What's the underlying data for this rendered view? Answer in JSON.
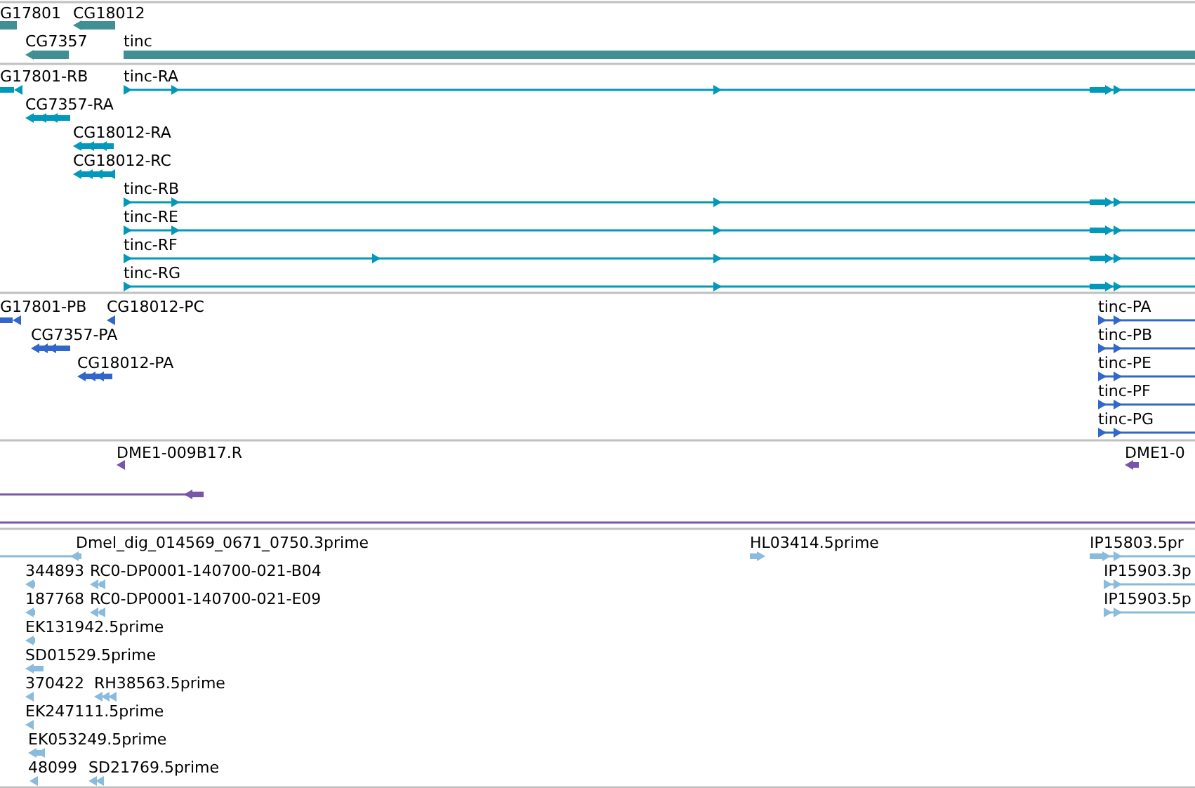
{
  "tracks": [
    {
      "color": "#3f8f93",
      "features": [
        {
          "label": "G17801"
        },
        {
          "label": "CG18012",
          "reverse": true
        },
        {
          "label": "CG7357",
          "reverse": true
        },
        {
          "label": "tinc"
        }
      ]
    },
    {
      "color": "#0099bb",
      "features": [
        {
          "label": "G17801-RB",
          "reverse": true
        },
        {
          "label": "tinc-RA",
          "reverse": false
        },
        {
          "label": "CG7357-RA",
          "reverse": true
        },
        {
          "label": "CG18012-RA",
          "reverse": true
        },
        {
          "label": "CG18012-RC",
          "reverse": true
        },
        {
          "label": "tinc-RB",
          "reverse": false
        },
        {
          "label": "tinc-RE",
          "reverse": false
        },
        {
          "label": "tinc-RF",
          "reverse": false
        },
        {
          "label": "tinc-RG",
          "reverse": false
        }
      ]
    },
    {
      "color": "#3366cc",
      "features": [
        {
          "label": "G17801-PB",
          "reverse": true
        },
        {
          "label": "CG18012-PC",
          "reverse": true
        },
        {
          "label": "CG7357-PA",
          "reverse": true
        },
        {
          "label": "CG18012-PA",
          "reverse": true
        },
        {
          "label": "tinc-PA",
          "reverse": false
        },
        {
          "label": "tinc-PB",
          "reverse": false
        },
        {
          "label": "tinc-PE",
          "reverse": false
        },
        {
          "label": "tinc-PF",
          "reverse": false
        },
        {
          "label": "tinc-PG",
          "reverse": false
        }
      ]
    },
    {
      "color": "#7755aa",
      "features": [
        {
          "label": "DME1-009B17.R",
          "reverse": true
        },
        {
          "reverse": true
        },
        {
          "label": "DME1-0",
          "reverse": true
        }
      ]
    },
    {
      "color": "#88bbdd",
      "features": [
        {
          "label": "Dmel_dig_014569_0671_0750.3prime",
          "reverse": true
        },
        {
          "label": "344893",
          "reverse": true
        },
        {
          "label": "RC0-DP0001-140700-021-B04",
          "reverse": true
        },
        {
          "label": "187768",
          "reverse": true
        },
        {
          "label": "RC0-DP0001-140700-021-E09",
          "reverse": true
        },
        {
          "label": "EK131942.5prime",
          "reverse": true
        },
        {
          "label": "SD01529.5prime",
          "reverse": true
        },
        {
          "label": "370422",
          "reverse": true
        },
        {
          "label": "RH38563.5prime",
          "reverse": true
        },
        {
          "label": "EK247111.5prime",
          "reverse": true
        },
        {
          "label": "EK053249.5prime",
          "reverse": true
        },
        {
          "label": "48099",
          "reverse": true
        },
        {
          "label": "SD21769.5prime",
          "reverse": true
        },
        {
          "label": "HL03414.5prime",
          "reverse": false
        },
        {
          "label": "IP15803.5pr",
          "reverse": false
        },
        {
          "label": "IP15903.3p",
          "reverse": false
        },
        {
          "label": "IP15903.5p",
          "reverse": false
        }
      ]
    }
  ]
}
